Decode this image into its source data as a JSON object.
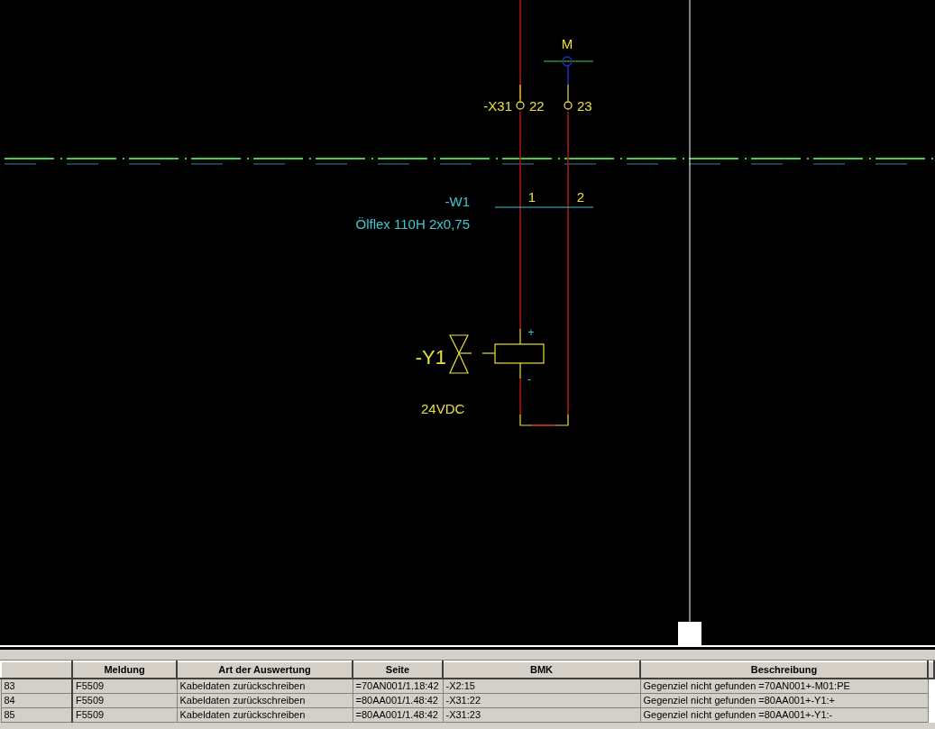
{
  "schematic": {
    "motor_label": "M",
    "terminal_strip": "-X31",
    "terminals": [
      "22",
      "23"
    ],
    "cable": {
      "name": "-W1",
      "type": "Ölflex 110H 2x0,75",
      "wires": [
        "1",
        "2"
      ]
    },
    "device": {
      "name": "-Y1",
      "voltage": "24VDC",
      "pins": [
        "+",
        "-"
      ]
    }
  },
  "table": {
    "columns": [
      "",
      "Meldung",
      "Art der Auswertung",
      "Seite",
      "BMK",
      "Beschreibung"
    ],
    "rows": [
      {
        "cells": [
          "83",
          "F5509",
          "Kabeldaten zurückschreiben",
          "=70AN001/1.18:42",
          "-X2:15",
          "Gegenziel nicht gefunden =70AN001+-M01:PE"
        ]
      },
      {
        "cells": [
          "84",
          "F5509",
          "Kabeldaten zurückschreiben",
          "=80AA001/1.48:42",
          "-X31:22",
          "Gegenziel nicht gefunden =80AA001+-Y1:+"
        ]
      },
      {
        "cells": [
          "85",
          "F5509",
          "Kabeldaten zurückschreiben",
          "=80AA001/1.48:42",
          "-X31:23",
          "Gegenziel nicht gefunden =80AA001+-Y1:-"
        ]
      }
    ]
  }
}
